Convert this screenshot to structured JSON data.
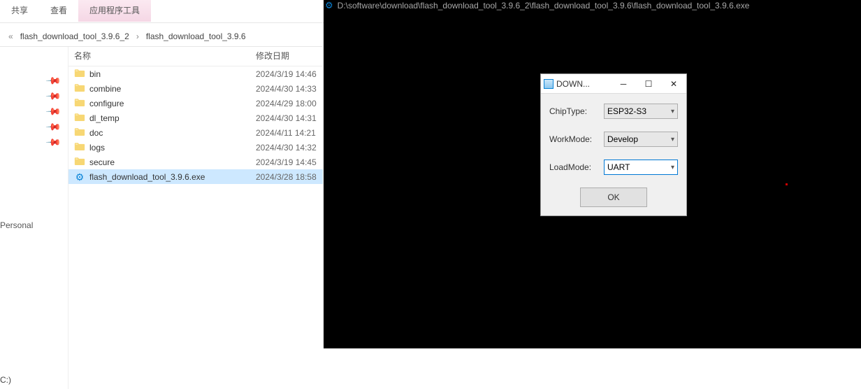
{
  "explorer": {
    "tabs": {
      "share": "共享",
      "view": "查看",
      "app_tools": "应用程序工具"
    },
    "breadcrumb": {
      "prefix": "«",
      "parts": [
        "flash_download_tool_3.9.6_2",
        "flash_download_tool_3.9.6"
      ],
      "sep": "›"
    },
    "headers": {
      "name": "名称",
      "date": "修改日期"
    },
    "sidebar": {
      "personal": "Personal",
      "drive": "C:)"
    },
    "rows": [
      {
        "kind": "folder",
        "name": "bin",
        "date": "2024/3/19 14:46"
      },
      {
        "kind": "folder",
        "name": "combine",
        "date": "2024/4/30 14:33"
      },
      {
        "kind": "folder",
        "name": "configure",
        "date": "2024/4/29 18:00"
      },
      {
        "kind": "folder",
        "name": "dl_temp",
        "date": "2024/4/30 14:31"
      },
      {
        "kind": "folder",
        "name": "doc",
        "date": "2024/4/11 14:21"
      },
      {
        "kind": "folder",
        "name": "logs",
        "date": "2024/4/30 14:32"
      },
      {
        "kind": "folder",
        "name": "secure",
        "date": "2024/3/19 14:45"
      },
      {
        "kind": "exe",
        "name": "flash_download_tool_3.9.6.exe",
        "date": "2024/3/28 18:58",
        "selected": true
      }
    ]
  },
  "console": {
    "icon": "⚙",
    "title": "D:\\software\\download\\flash_download_tool_3.9.6_2\\flash_download_tool_3.9.6\\flash_download_tool_3.9.6.exe"
  },
  "dialog": {
    "title": "DOWN...",
    "chip_label": "ChipType:",
    "chip_value": "ESP32-S3",
    "work_label": "WorkMode:",
    "work_value": "Develop",
    "load_label": "LoadMode:",
    "load_value": "UART",
    "ok": "OK"
  }
}
